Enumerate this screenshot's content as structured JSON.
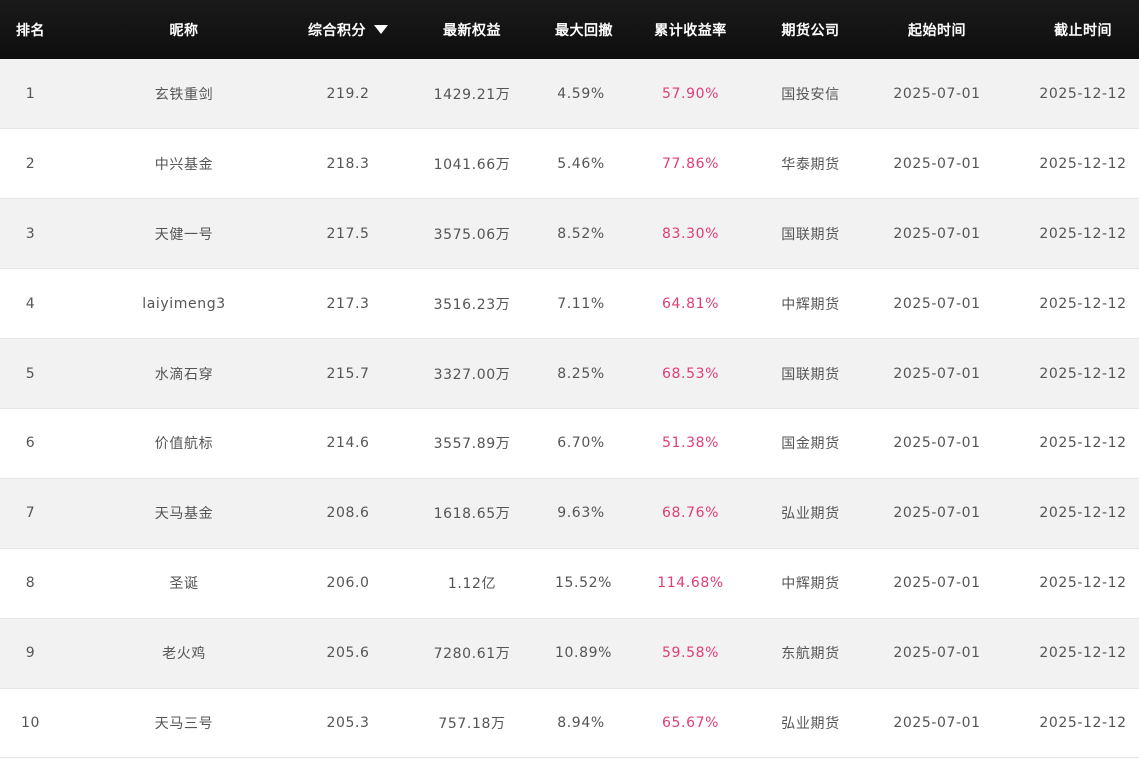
{
  "headers": {
    "rank": "排名",
    "nickname": "昵称",
    "score": "综合积分",
    "equity": "最新权益",
    "max_drawdown": "最大回撤",
    "cumulative_return": "累计收益率",
    "company": "期货公司",
    "start_time": "起始时间",
    "end_time": "截止时间"
  },
  "sort_icon": "caret-down-icon",
  "colors": {
    "header_bg": "#111111",
    "return_text": "#e03c7a",
    "row_alt": "#f2f2f2"
  },
  "rows": [
    {
      "rank": "1",
      "nickname": "玄铁重剑",
      "score": "219.2",
      "equity": "1429.21万",
      "max_drawdown": "4.59%",
      "cumulative_return": "57.90%",
      "company": "国投安信",
      "start_time": "2025-07-01",
      "end_time": "2025-12-12"
    },
    {
      "rank": "2",
      "nickname": "中兴基金",
      "score": "218.3",
      "equity": "1041.66万",
      "max_drawdown": "5.46%",
      "cumulative_return": "77.86%",
      "company": "华泰期货",
      "start_time": "2025-07-01",
      "end_time": "2025-12-12"
    },
    {
      "rank": "3",
      "nickname": "天健一号",
      "score": "217.5",
      "equity": "3575.06万",
      "max_drawdown": "8.52%",
      "cumulative_return": "83.30%",
      "company": "国联期货",
      "start_time": "2025-07-01",
      "end_time": "2025-12-12"
    },
    {
      "rank": "4",
      "nickname": "laiyimeng3",
      "score": "217.3",
      "equity": "3516.23万",
      "max_drawdown": "7.11%",
      "cumulative_return": "64.81%",
      "company": "中辉期货",
      "start_time": "2025-07-01",
      "end_time": "2025-12-12"
    },
    {
      "rank": "5",
      "nickname": "水滴石穿",
      "score": "215.7",
      "equity": "3327.00万",
      "max_drawdown": "8.25%",
      "cumulative_return": "68.53%",
      "company": "国联期货",
      "start_time": "2025-07-01",
      "end_time": "2025-12-12"
    },
    {
      "rank": "6",
      "nickname": "价值航标",
      "score": "214.6",
      "equity": "3557.89万",
      "max_drawdown": "6.70%",
      "cumulative_return": "51.38%",
      "company": "国金期货",
      "start_time": "2025-07-01",
      "end_time": "2025-12-12"
    },
    {
      "rank": "7",
      "nickname": "天马基金",
      "score": "208.6",
      "equity": "1618.65万",
      "max_drawdown": "9.63%",
      "cumulative_return": "68.76%",
      "company": "弘业期货",
      "start_time": "2025-07-01",
      "end_time": "2025-12-12"
    },
    {
      "rank": "8",
      "nickname": "圣诞",
      "score": "206.0",
      "equity": "1.12亿",
      "max_drawdown": "15.52%",
      "cumulative_return": "114.68%",
      "company": "中辉期货",
      "start_time": "2025-07-01",
      "end_time": "2025-12-12"
    },
    {
      "rank": "9",
      "nickname": "老火鸡",
      "score": "205.6",
      "equity": "7280.61万",
      "max_drawdown": "10.89%",
      "cumulative_return": "59.58%",
      "company": "东航期货",
      "start_time": "2025-07-01",
      "end_time": "2025-12-12"
    },
    {
      "rank": "10",
      "nickname": "天马三号",
      "score": "205.3",
      "equity": "757.18万",
      "max_drawdown": "8.94%",
      "cumulative_return": "65.67%",
      "company": "弘业期货",
      "start_time": "2025-07-01",
      "end_time": "2025-12-12"
    }
  ]
}
